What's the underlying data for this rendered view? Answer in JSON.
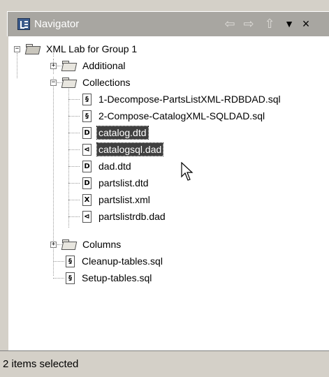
{
  "titlebar": {
    "title": "Navigator",
    "back_icon": "⇦",
    "forward_icon": "⇨",
    "up_icon": "⇧",
    "menu_icon": "▼",
    "close_icon": "×"
  },
  "tree": {
    "project": "XML Lab for Group 1",
    "additional": "Additional",
    "collections": "Collections",
    "collections_items": [
      {
        "label": "1-Decompose-PartsListXML-RDBDAD.sql",
        "icon": "sql-file-icon",
        "glyph": "§"
      },
      {
        "label": "2-Compose-CatalogXML-SQLDAD.sql",
        "icon": "sql-file-icon",
        "glyph": "§"
      },
      {
        "label": "catalog.dtd",
        "icon": "dtd-file-icon",
        "glyph": "D"
      },
      {
        "label": "catalogsql.dad",
        "icon": "dad-file-icon",
        "glyph": "⊲"
      },
      {
        "label": "dad.dtd",
        "icon": "dtd-file-icon",
        "glyph": "D"
      },
      {
        "label": "partslist.dtd",
        "icon": "dtd-file-icon",
        "glyph": "D"
      },
      {
        "label": "partslist.xml",
        "icon": "xml-file-icon",
        "glyph": "X"
      },
      {
        "label": "partslistrdb.dad",
        "icon": "dad-file-icon",
        "glyph": "⊲"
      }
    ],
    "columns": "Columns",
    "root_files": [
      {
        "label": "Cleanup-tables.sql",
        "icon": "sql-file-icon",
        "glyph": "§"
      },
      {
        "label": "Setup-tables.sql",
        "icon": "sql-file-icon",
        "glyph": "§"
      }
    ]
  },
  "status": {
    "text": "2 items selected"
  }
}
